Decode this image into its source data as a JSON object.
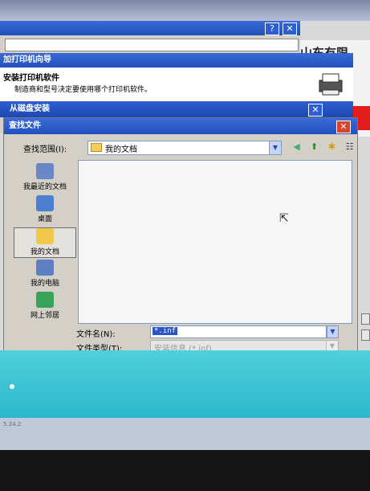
{
  "colors": {
    "titlebar": "#2150bd",
    "file_pane": "#f6f6f6",
    "selection": "#2b55c8",
    "cyan_band": "#36c0d1"
  },
  "background": {
    "ad_text": "山东有限"
  },
  "win1": {
    "help_glyph": "?",
    "close_glyph": "✕"
  },
  "wizard": {
    "title": "加打印机向导",
    "header_title": "安装打印机软件",
    "header_subtitle": "制造商和型号决定要使用哪个打印机软件。",
    "icon": "printer-icon"
  },
  "install_disk": {
    "title": "从磁盘安装",
    "close_glyph": "✕"
  },
  "locate": {
    "title": "查找文件",
    "close_glyph": "✕",
    "look_in_label": "查找范围(I):",
    "look_in_value": "我的文档",
    "toolbar": {
      "back_icon": "back-icon",
      "up_icon": "up-folder-icon",
      "new_folder_icon": "new-folder-icon",
      "view_menu_icon": "view-menu-icon"
    },
    "places": [
      {
        "label": "我最近的文档",
        "icon": "recent-documents-icon",
        "color": "#6b87c6"
      },
      {
        "label": "桌面",
        "icon": "desktop-icon",
        "color": "#4c7fd0"
      },
      {
        "label": "我的文档",
        "icon": "my-documents-icon",
        "color": "#f0c94b"
      },
      {
        "label": "我的电脑",
        "icon": "my-computer-icon",
        "color": "#5b7fc2"
      },
      {
        "label": "网上邻居",
        "icon": "network-places-icon",
        "color": "#3aa35a"
      }
    ],
    "file_name_label": "文件名(N):",
    "file_name_value": "*.inf",
    "file_type_label": "文件类型(T):",
    "file_type_value": "安装信息 (*.inf)"
  },
  "taskbar": {
    "version": "5.24.2"
  }
}
